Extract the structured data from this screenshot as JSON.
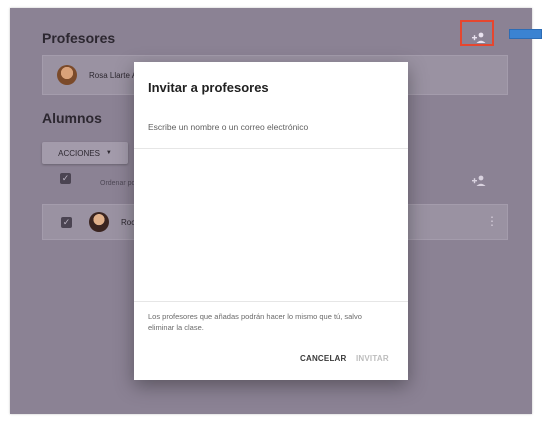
{
  "background": {
    "teachers_title": "Profesores",
    "teacher_name": "Rosa Llarte A",
    "students_title": "Alumnos",
    "actions_label": "ACCIONES",
    "actions_caret": "▼",
    "sort_label": "Ordenar por",
    "student_name": "Roc"
  },
  "dialog": {
    "title": "Invitar a profesores",
    "input_placeholder": "Escribe un nombre o un correo electrónico",
    "info_text": "Los profesores que añadas podrán hacer lo mismo que tú, salvo eliminar la clase.",
    "cancel_label": "CANCELAR",
    "invite_label": "INVITAR"
  },
  "icons": {
    "add_teacher": "person-add-icon",
    "add_student": "person-add-icon",
    "row_menu": "more-vert-icon",
    "checkbox": "check-icon"
  },
  "colors": {
    "overlay": "#8b8294",
    "highlight": "#e6462f",
    "accent_tab": "#3b83d2",
    "invite_disabled": "#bdbdbd"
  }
}
